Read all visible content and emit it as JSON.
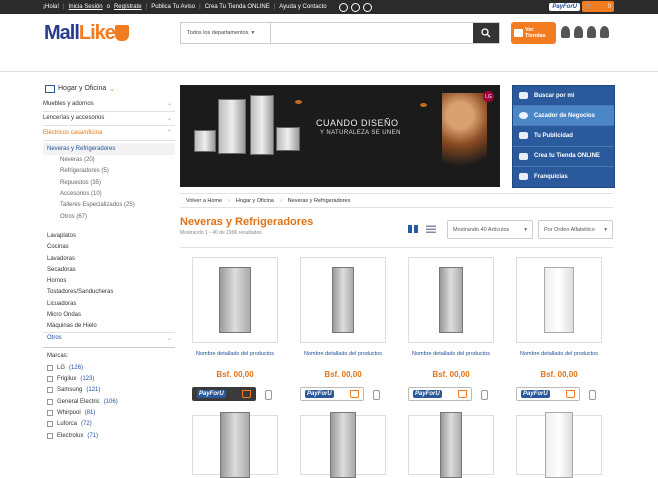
{
  "topbar": {
    "greeting": "¡Hola!",
    "login": "Inicia Sesión",
    "or": "o",
    "register": "Regístrate",
    "links": [
      "Publica Tu Aviso",
      "Crea Tu Tienda ONLINE",
      "Ayuda y Contacto"
    ],
    "payforu": "PayForU",
    "cart_count": "0"
  },
  "header": {
    "logo_text_1": "Mall",
    "logo_text_2": "Like",
    "search": {
      "department": "Todos los departamentos",
      "placeholder": ""
    },
    "ver_tiendas": "Ver Tiendas"
  },
  "sidebar": {
    "category_title": "Hogar y Oficina",
    "menu": [
      {
        "label": "Muebles y adornos"
      },
      {
        "label": "Lencerías y accesorios"
      },
      {
        "label": "Eléctricos casa/oficina"
      }
    ],
    "active_sub": "Neveras y Refrigeradores",
    "sub_items": [
      "Neveras (20)",
      "Refrigeradores (5)",
      "Repuestos (35)",
      "Accesorios (10)",
      "Talleres Especializados (25)",
      "Otros (67)"
    ],
    "others": [
      "Lavaplatos",
      "Cocinas",
      "Lavadoras",
      "Secadoras",
      "Hornos",
      "Tostadores/Sanducheras",
      "Licuadoras",
      "Micro Ondas",
      "Máquinas de Hielo"
    ],
    "otros_label": "Otros",
    "marcas_title": "Marcas:",
    "brands": [
      {
        "name": "LG",
        "count": "(126)"
      },
      {
        "name": "Frigilux",
        "count": "(123)"
      },
      {
        "name": "Samsung",
        "count": "(121)"
      },
      {
        "name": "General Electric",
        "count": "(106)"
      },
      {
        "name": "Whirpool",
        "count": "(81)"
      },
      {
        "name": "Luforca",
        "count": "(72)"
      },
      {
        "name": "Electrolux",
        "count": "(71)"
      }
    ]
  },
  "banner": {
    "line1": "CUANDO DISEÑO",
    "line2": "Y NATURALEZA SE UNEN",
    "brand": "LG"
  },
  "right_menu": [
    {
      "label": "Buscar por mi"
    },
    {
      "label": "Cazador de Negocios"
    },
    {
      "label": "Tu Publicidad"
    },
    {
      "label": "Crea tu Tienda ONLINE"
    },
    {
      "label": "Franquicias"
    }
  ],
  "breadcrumb": [
    "Volver a Home",
    "Hogar y Oficina",
    "Neveras y Refrigeradores"
  ],
  "page": {
    "title": "Neveras y Refrigeradores",
    "results": "Mostrando 1 - 40 de 1996 resultados",
    "per_page": "Mostrando 40 Artículos",
    "sort": "Por Orden Alfabético"
  },
  "products": [
    {
      "name": "Nombre detallado del productos",
      "price": "Bsf. 00,00",
      "buy": "PayForU"
    },
    {
      "name": "Nombre detallado del productos",
      "price": "Bsf. 00,00",
      "buy": "PayForU"
    },
    {
      "name": "Nombre detallado del productos",
      "price": "Bsf. 00,00",
      "buy": "PayForU"
    },
    {
      "name": "Nombre detallado del productos",
      "price": "Bsf. 00,00",
      "buy": "PayForU"
    }
  ]
}
